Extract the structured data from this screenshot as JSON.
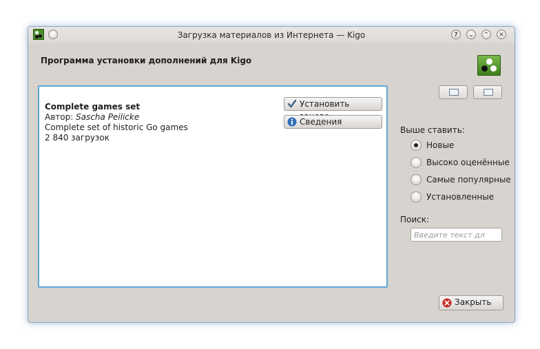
{
  "window": {
    "title": "Загрузка материалов из Интернета — Kigo",
    "buttons": {
      "help": "?",
      "minimize": "⌄",
      "maximize": "⌃",
      "close": "✕"
    }
  },
  "header": {
    "title": "Программа установки дополнений для Kigo"
  },
  "items": [
    {
      "name": "Complete games set",
      "author_label": "Автор: ",
      "author": "Sascha Peilicke",
      "description": "Complete set of historic Go games",
      "downloads": "2 840 загрузок",
      "actions": {
        "reinstall": "Установить заново",
        "details": "Сведения"
      }
    }
  ],
  "sidebar": {
    "sort_label": "Выше ставить:",
    "sort_options": [
      "Новые",
      "Высоко оценённые",
      "Самые популярные",
      "Установленные"
    ],
    "selected_sort": "Новые",
    "search_label": "Поиск:",
    "search_placeholder": "Введите текст дл"
  },
  "footer": {
    "close_label": "Закрыть"
  }
}
